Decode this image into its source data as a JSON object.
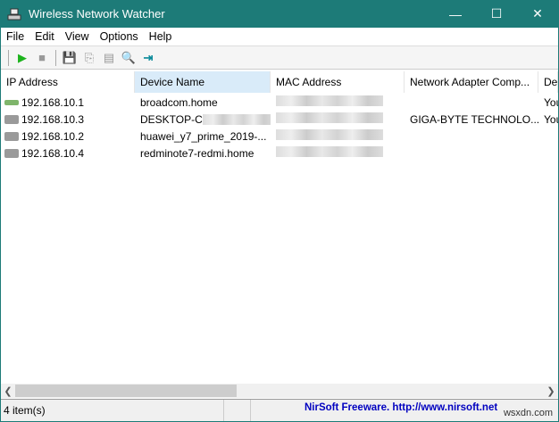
{
  "window": {
    "title": "Wireless Network Watcher",
    "minimize": "—",
    "maximize": "☐",
    "close": "✕"
  },
  "menu": [
    "File",
    "Edit",
    "View",
    "Options",
    "Help"
  ],
  "toolbar": {
    "start": "▶",
    "stop": "■",
    "save": "💾",
    "copy": "⎘",
    "properties": "▤",
    "find": "🔍",
    "exit": "⇥"
  },
  "columns": [
    "IP Address",
    "Device Name",
    "MAC Address",
    "Network Adapter Comp...",
    "Dev"
  ],
  "rows": [
    {
      "ip": "192.168.10.1",
      "name": "broadcom.home",
      "adapter": "",
      "dev": "You",
      "icon": "router"
    },
    {
      "ip": "192.168.10.3",
      "name": "DESKTOP-C",
      "adapter": "GIGA-BYTE TECHNOLO...",
      "dev": "You",
      "icon": "computer"
    },
    {
      "ip": "192.168.10.2",
      "name": "huawei_y7_prime_2019-...",
      "adapter": "",
      "dev": "",
      "icon": "computer"
    },
    {
      "ip": "192.168.10.4",
      "name": "redminote7-redmi.home",
      "adapter": "",
      "dev": "",
      "icon": "computer"
    }
  ],
  "status": {
    "count": "4 item(s)",
    "link": "NirSoft Freeware.  http://www.nirsoft.net"
  },
  "watermark": "wsxdn.com",
  "colors": {
    "titlebar": "#1d7b78",
    "link": "#0000c0",
    "sorted": "#d9ebf9"
  }
}
